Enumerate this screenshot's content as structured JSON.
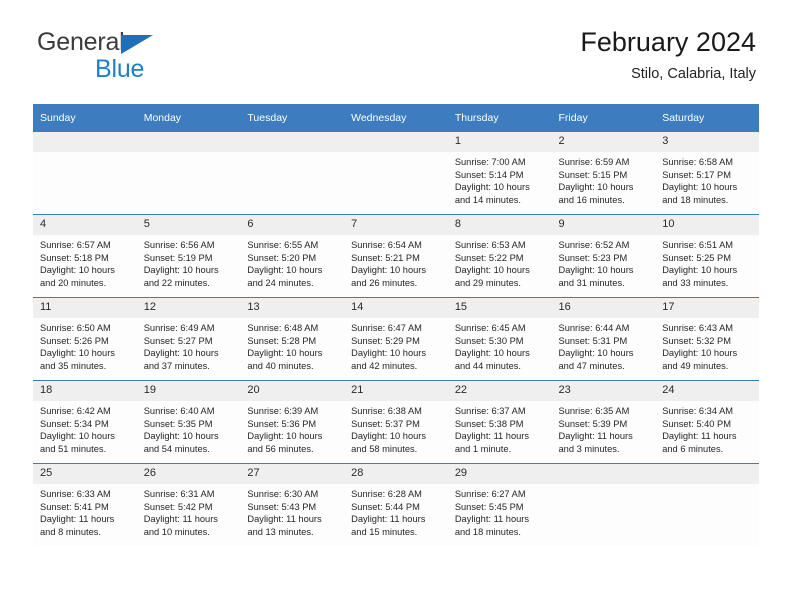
{
  "brand": {
    "name_part1": "General",
    "name_part2": "Blue"
  },
  "header": {
    "title": "February 2024",
    "subtitle": "Stilo, Calabria, Italy"
  },
  "colors": {
    "header_blue": "#3c7cbf",
    "logo_blue": "#1d7fd0",
    "daynum_bg": "#efefef"
  },
  "weekday_headers": [
    "Sunday",
    "Monday",
    "Tuesday",
    "Wednesday",
    "Thursday",
    "Friday",
    "Saturday"
  ],
  "labels": {
    "sunrise": "Sunrise:",
    "sunset": "Sunset:",
    "daylight": "Daylight:"
  },
  "weeks": [
    [
      {
        "day": "",
        "empty": true
      },
      {
        "day": "",
        "empty": true
      },
      {
        "day": "",
        "empty": true
      },
      {
        "day": "",
        "empty": true
      },
      {
        "day": "1",
        "sunrise": "Sunrise: 7:00 AM",
        "sunset": "Sunset: 5:14 PM",
        "daylight_line1": "Daylight: 10 hours",
        "daylight_line2": "and 14 minutes."
      },
      {
        "day": "2",
        "sunrise": "Sunrise: 6:59 AM",
        "sunset": "Sunset: 5:15 PM",
        "daylight_line1": "Daylight: 10 hours",
        "daylight_line2": "and 16 minutes."
      },
      {
        "day": "3",
        "sunrise": "Sunrise: 6:58 AM",
        "sunset": "Sunset: 5:17 PM",
        "daylight_line1": "Daylight: 10 hours",
        "daylight_line2": "and 18 minutes."
      }
    ],
    [
      {
        "day": "4",
        "sunrise": "Sunrise: 6:57 AM",
        "sunset": "Sunset: 5:18 PM",
        "daylight_line1": "Daylight: 10 hours",
        "daylight_line2": "and 20 minutes."
      },
      {
        "day": "5",
        "sunrise": "Sunrise: 6:56 AM",
        "sunset": "Sunset: 5:19 PM",
        "daylight_line1": "Daylight: 10 hours",
        "daylight_line2": "and 22 minutes."
      },
      {
        "day": "6",
        "sunrise": "Sunrise: 6:55 AM",
        "sunset": "Sunset: 5:20 PM",
        "daylight_line1": "Daylight: 10 hours",
        "daylight_line2": "and 24 minutes."
      },
      {
        "day": "7",
        "sunrise": "Sunrise: 6:54 AM",
        "sunset": "Sunset: 5:21 PM",
        "daylight_line1": "Daylight: 10 hours",
        "daylight_line2": "and 26 minutes."
      },
      {
        "day": "8",
        "sunrise": "Sunrise: 6:53 AM",
        "sunset": "Sunset: 5:22 PM",
        "daylight_line1": "Daylight: 10 hours",
        "daylight_line2": "and 29 minutes."
      },
      {
        "day": "9",
        "sunrise": "Sunrise: 6:52 AM",
        "sunset": "Sunset: 5:23 PM",
        "daylight_line1": "Daylight: 10 hours",
        "daylight_line2": "and 31 minutes."
      },
      {
        "day": "10",
        "sunrise": "Sunrise: 6:51 AM",
        "sunset": "Sunset: 5:25 PM",
        "daylight_line1": "Daylight: 10 hours",
        "daylight_line2": "and 33 minutes."
      }
    ],
    [
      {
        "day": "11",
        "sunrise": "Sunrise: 6:50 AM",
        "sunset": "Sunset: 5:26 PM",
        "daylight_line1": "Daylight: 10 hours",
        "daylight_line2": "and 35 minutes."
      },
      {
        "day": "12",
        "sunrise": "Sunrise: 6:49 AM",
        "sunset": "Sunset: 5:27 PM",
        "daylight_line1": "Daylight: 10 hours",
        "daylight_line2": "and 37 minutes."
      },
      {
        "day": "13",
        "sunrise": "Sunrise: 6:48 AM",
        "sunset": "Sunset: 5:28 PM",
        "daylight_line1": "Daylight: 10 hours",
        "daylight_line2": "and 40 minutes."
      },
      {
        "day": "14",
        "sunrise": "Sunrise: 6:47 AM",
        "sunset": "Sunset: 5:29 PM",
        "daylight_line1": "Daylight: 10 hours",
        "daylight_line2": "and 42 minutes."
      },
      {
        "day": "15",
        "sunrise": "Sunrise: 6:45 AM",
        "sunset": "Sunset: 5:30 PM",
        "daylight_line1": "Daylight: 10 hours",
        "daylight_line2": "and 44 minutes."
      },
      {
        "day": "16",
        "sunrise": "Sunrise: 6:44 AM",
        "sunset": "Sunset: 5:31 PM",
        "daylight_line1": "Daylight: 10 hours",
        "daylight_line2": "and 47 minutes."
      },
      {
        "day": "17",
        "sunrise": "Sunrise: 6:43 AM",
        "sunset": "Sunset: 5:32 PM",
        "daylight_line1": "Daylight: 10 hours",
        "daylight_line2": "and 49 minutes."
      }
    ],
    [
      {
        "day": "18",
        "sunrise": "Sunrise: 6:42 AM",
        "sunset": "Sunset: 5:34 PM",
        "daylight_line1": "Daylight: 10 hours",
        "daylight_line2": "and 51 minutes."
      },
      {
        "day": "19",
        "sunrise": "Sunrise: 6:40 AM",
        "sunset": "Sunset: 5:35 PM",
        "daylight_line1": "Daylight: 10 hours",
        "daylight_line2": "and 54 minutes."
      },
      {
        "day": "20",
        "sunrise": "Sunrise: 6:39 AM",
        "sunset": "Sunset: 5:36 PM",
        "daylight_line1": "Daylight: 10 hours",
        "daylight_line2": "and 56 minutes."
      },
      {
        "day": "21",
        "sunrise": "Sunrise: 6:38 AM",
        "sunset": "Sunset: 5:37 PM",
        "daylight_line1": "Daylight: 10 hours",
        "daylight_line2": "and 58 minutes."
      },
      {
        "day": "22",
        "sunrise": "Sunrise: 6:37 AM",
        "sunset": "Sunset: 5:38 PM",
        "daylight_line1": "Daylight: 11 hours",
        "daylight_line2": "and 1 minute."
      },
      {
        "day": "23",
        "sunrise": "Sunrise: 6:35 AM",
        "sunset": "Sunset: 5:39 PM",
        "daylight_line1": "Daylight: 11 hours",
        "daylight_line2": "and 3 minutes."
      },
      {
        "day": "24",
        "sunrise": "Sunrise: 6:34 AM",
        "sunset": "Sunset: 5:40 PM",
        "daylight_line1": "Daylight: 11 hours",
        "daylight_line2": "and 6 minutes."
      }
    ],
    [
      {
        "day": "25",
        "sunrise": "Sunrise: 6:33 AM",
        "sunset": "Sunset: 5:41 PM",
        "daylight_line1": "Daylight: 11 hours",
        "daylight_line2": "and 8 minutes."
      },
      {
        "day": "26",
        "sunrise": "Sunrise: 6:31 AM",
        "sunset": "Sunset: 5:42 PM",
        "daylight_line1": "Daylight: 11 hours",
        "daylight_line2": "and 10 minutes."
      },
      {
        "day": "27",
        "sunrise": "Sunrise: 6:30 AM",
        "sunset": "Sunset: 5:43 PM",
        "daylight_line1": "Daylight: 11 hours",
        "daylight_line2": "and 13 minutes."
      },
      {
        "day": "28",
        "sunrise": "Sunrise: 6:28 AM",
        "sunset": "Sunset: 5:44 PM",
        "daylight_line1": "Daylight: 11 hours",
        "daylight_line2": "and 15 minutes."
      },
      {
        "day": "29",
        "sunrise": "Sunrise: 6:27 AM",
        "sunset": "Sunset: 5:45 PM",
        "daylight_line1": "Daylight: 11 hours",
        "daylight_line2": "and 18 minutes."
      },
      {
        "day": "",
        "empty": true
      },
      {
        "day": "",
        "empty": true
      }
    ]
  ]
}
